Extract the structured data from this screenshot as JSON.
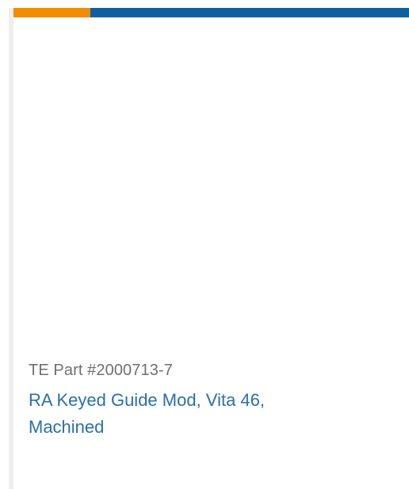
{
  "colors": {
    "accent_orange": "#f28c00",
    "accent_blue": "#0f5f9e",
    "link_blue": "#2a6fa8",
    "muted_text": "#6f6f6f"
  },
  "product": {
    "part_number": "TE Part #2000713-7",
    "title": "RA Keyed Guide Mod, Vita 46, Machined"
  }
}
